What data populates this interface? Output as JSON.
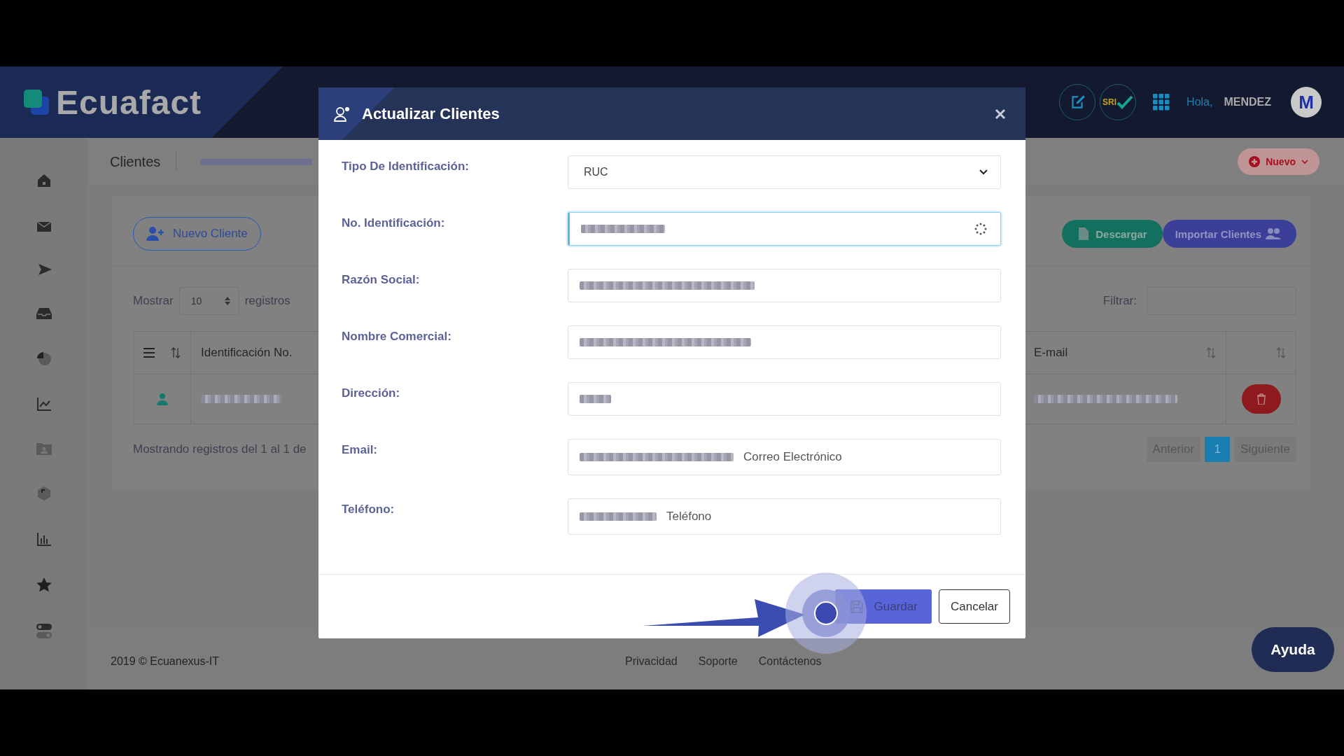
{
  "brand": {
    "name": "Ecuafact"
  },
  "header": {
    "sri_label": "SRI",
    "greeting": "Hola,",
    "user": "MENDEZ",
    "avatar_letter": "M"
  },
  "breadcrumb": {
    "title": "Clientes",
    "new_menu": "Nuevo"
  },
  "toolbar": {
    "new_client": "Nuevo Cliente",
    "download": "Descargar",
    "import": "Importar Clientes"
  },
  "length": {
    "prefix": "Mostrar",
    "value": "10",
    "suffix": "registros"
  },
  "filter": {
    "label": "Filtrar:"
  },
  "table": {
    "columns": [
      "Identificación No.",
      "E-mail"
    ]
  },
  "info": "Mostrando registros del 1 al 1 de",
  "pagination": {
    "previous": "Anterior",
    "pages": [
      {
        "label": "1",
        "selected": true
      }
    ],
    "next": "Siguiente"
  },
  "footer": {
    "copyright": "2019 © Ecuanexus-IT",
    "links": [
      "Privacidad",
      "Soporte",
      "Contáctenos"
    ]
  },
  "help": "Ayuda",
  "modal": {
    "title": "Actualizar Clientes",
    "fields": [
      {
        "label": "Tipo De Identificación:",
        "kind": "select",
        "value": "RUC"
      },
      {
        "label": "No. Identificación:",
        "kind": "input",
        "redacted": true,
        "focused": true,
        "loading": true
      },
      {
        "label": "Razón Social:",
        "kind": "input",
        "redacted": true,
        "focused": false
      },
      {
        "label": "Nombre Comercial:",
        "kind": "input",
        "redacted": true,
        "focused": false
      },
      {
        "label": "Dirección:",
        "kind": "input",
        "redacted": true,
        "focused": false
      },
      {
        "label": "Email:",
        "kind": "input",
        "redacted": true,
        "focused": false,
        "hint": "Correo Electrónico"
      },
      {
        "label": "Teléfono:",
        "kind": "input",
        "redacted": true,
        "focused": false,
        "hint": "Teléfono"
      }
    ],
    "buttons": [
      {
        "label": "Guardar",
        "kind": "primary"
      },
      {
        "label": "Cancelar",
        "kind": "secondary"
      }
    ]
  }
}
